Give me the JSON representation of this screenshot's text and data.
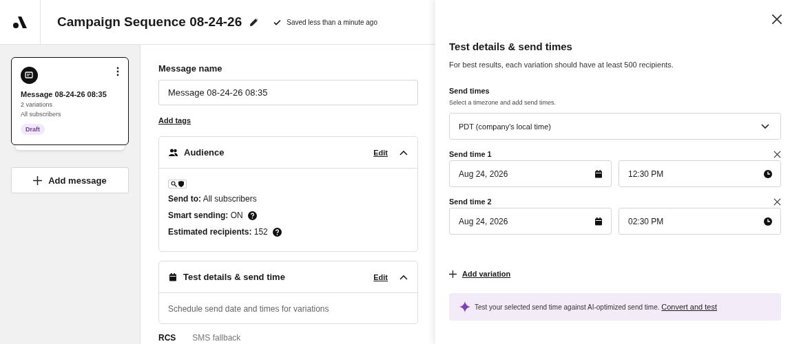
{
  "header": {
    "title": "Campaign Sequence 08-24-26",
    "save_status": "Saved less than a minute ago"
  },
  "sidebar": {
    "messages": [
      {
        "name": "Message 08-24-26 08:35",
        "variations": "2 variations",
        "audience": "All subscribers",
        "status": "Draft",
        "selected": true
      }
    ],
    "add_button": "Add message"
  },
  "editor": {
    "name_label": "Message name",
    "name_value": "Message 08-24-26 08:35",
    "add_tags": "Add tags",
    "sections": [
      {
        "kind": "audience",
        "title": "Audience",
        "edit": "Edit",
        "expanded": true,
        "lines": [
          {
            "text": "**Send to:** All subscribers",
            "help": false
          },
          {
            "text": "**Smart sending:**  ON",
            "help": true
          },
          {
            "text": "**Estimated recipients:**  152",
            "help": true
          }
        ]
      },
      {
        "kind": "schedule",
        "title": "Test details & send time",
        "edit": "Edit",
        "expanded": true,
        "description": "Schedule send date and times for variations"
      }
    ],
    "tabs": [
      {
        "label": "RCS",
        "selected": true
      },
      {
        "label": "SMS fallback",
        "selected": false
      }
    ]
  },
  "drawer": {
    "title": "Test details & send times",
    "subtitle": "For best results, each variation should have at least 500 recipients.",
    "send_times_label": "Send times",
    "send_times_hint": "Select a timezone and add send times.",
    "timezone": "PDT (company's local time)",
    "send_times": [
      {
        "label": "Send time 1",
        "date": "Aug 24, 2026",
        "time": "12:30 PM"
      },
      {
        "label": "Send time 2",
        "date": "Aug 24, 2026",
        "time": "02:30 PM"
      }
    ],
    "add_variation": "Add variation",
    "banner_text": "Test your selected send time against AI-optimized send time.",
    "banner_link": "Convert and test"
  }
}
